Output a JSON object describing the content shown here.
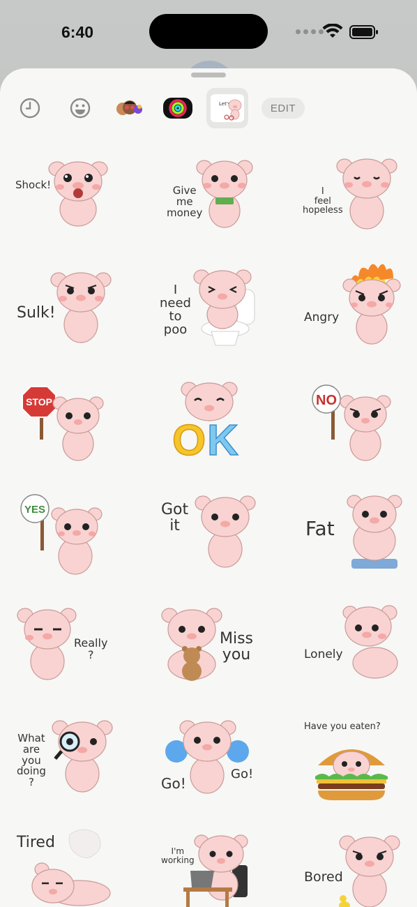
{
  "status": {
    "time": "6:40"
  },
  "tabs": [
    {
      "name": "recent",
      "icon": "clock-icon"
    },
    {
      "name": "emoji",
      "icon": "smiley-icon"
    },
    {
      "name": "memoji",
      "icon": "memoji-stickers-icon"
    },
    {
      "name": "activity",
      "icon": "activity-rings-icon"
    },
    {
      "name": "pig-sticker-pack",
      "icon": "pig-pack-thumbnail-icon",
      "thumb_text": "Let's go",
      "selected": true
    }
  ],
  "edit_label": "EDIT",
  "stickers": [
    {
      "label": "Shock!",
      "accent": ""
    },
    {
      "label": "Give\nme\nmoney",
      "accent": "money"
    },
    {
      "label": "I\nfeel\nhopeless",
      "accent": ""
    },
    {
      "label": "Sulk!",
      "accent": ""
    },
    {
      "label": "I\nneed\nto\npoo",
      "accent": "toilet"
    },
    {
      "label": "Angry",
      "accent": "fire"
    },
    {
      "label": "STOP",
      "accent": "stop-sign"
    },
    {
      "label": "OK",
      "accent": "ok-letters"
    },
    {
      "label": "NO",
      "accent": "no-sign"
    },
    {
      "label": "YES",
      "accent": "yes-sign"
    },
    {
      "label": "Got\nit",
      "accent": ""
    },
    {
      "label": "Fat",
      "accent": "scale"
    },
    {
      "label": "Really\n?",
      "accent": ""
    },
    {
      "label": "Miss\nyou",
      "accent": "teddy"
    },
    {
      "label": "Lonely",
      "accent": ""
    },
    {
      "label": "What\nare\nyou\ndoing\n?",
      "accent": "magnifier"
    },
    {
      "label": "Go!",
      "label2": "Go!",
      "accent": "pompoms"
    },
    {
      "label": "Have you eaten?",
      "accent": "burger"
    },
    {
      "label": "Tired",
      "accent": "ghost"
    },
    {
      "label": "I'm\nworking",
      "accent": "desk"
    },
    {
      "label": "Bored",
      "accent": "duck"
    }
  ],
  "colors": {
    "pig": "#f8d3d1",
    "pig_outline": "#c99a98",
    "cheek": "#f5a8a8",
    "sheet": "#f7f7f5"
  }
}
